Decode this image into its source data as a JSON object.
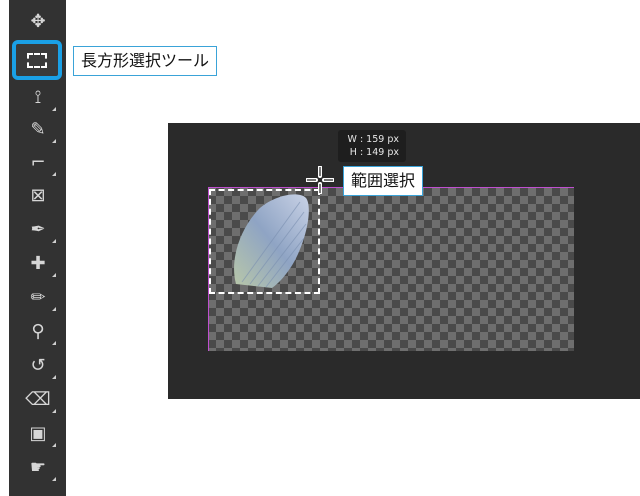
{
  "toolbar": {
    "tools": [
      {
        "id": "move",
        "icon": "move-icon",
        "glyph": "✥"
      },
      {
        "id": "rectangular-marquee",
        "icon": "rectangular-marquee-icon",
        "active": true
      },
      {
        "id": "lasso",
        "icon": "polygonal-lasso-icon",
        "glyph": "⟟"
      },
      {
        "id": "quick-selection",
        "icon": "quick-selection-icon",
        "glyph": "✎"
      },
      {
        "id": "crop",
        "icon": "crop-icon",
        "glyph": "⌐"
      },
      {
        "id": "frame",
        "icon": "frame-icon",
        "glyph": "⊠"
      },
      {
        "id": "eyedropper",
        "icon": "eyedropper-icon",
        "glyph": "✒"
      },
      {
        "id": "healing",
        "icon": "healing-brush-icon",
        "glyph": "✚"
      },
      {
        "id": "brush",
        "icon": "brush-icon",
        "glyph": "✏"
      },
      {
        "id": "stamp",
        "icon": "clone-stamp-icon",
        "glyph": "⚲"
      },
      {
        "id": "history-brush",
        "icon": "history-brush-icon",
        "glyph": "↺"
      },
      {
        "id": "eraser",
        "icon": "eraser-icon",
        "glyph": "⌫"
      },
      {
        "id": "gradient",
        "icon": "gradient-icon",
        "glyph": "▣"
      },
      {
        "id": "smudge",
        "icon": "smudge-icon",
        "glyph": "☛"
      }
    ]
  },
  "callouts": {
    "tool_name": "長方形選択ツール",
    "selection_name": "範囲選択"
  },
  "size_tooltip": {
    "width_line": "W : 159 px",
    "height_line": "H : 149 px"
  },
  "colors": {
    "accent": "#1aa0e6",
    "guide": "#c04fd0",
    "toolbar_bg": "#323232",
    "workspace_bg": "#2a2a2a"
  }
}
